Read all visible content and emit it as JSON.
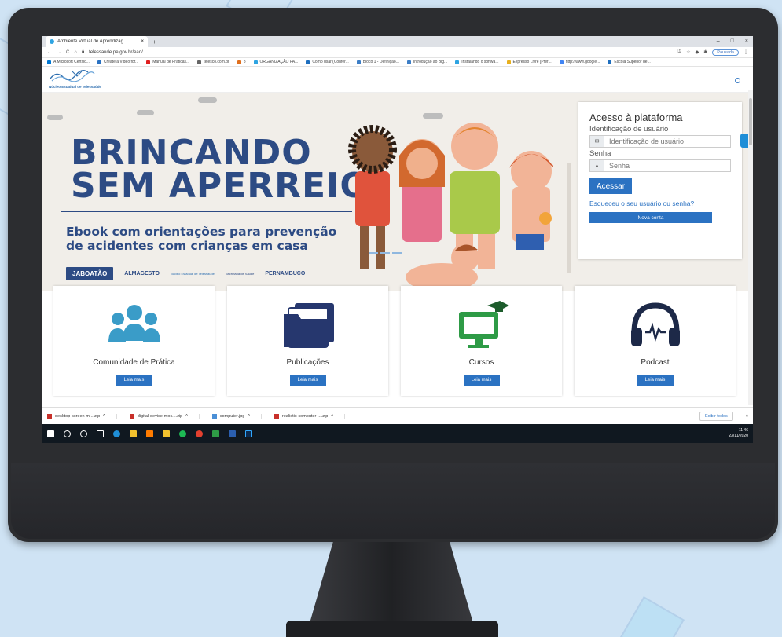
{
  "browser": {
    "tab_title": "Ambiente Virtual de Aprendizag",
    "tab_close": "×",
    "new_tab": "+",
    "window_controls": [
      "–",
      "□",
      "×"
    ],
    "url": "telessaude.pe.gov.br/ead/",
    "paused_label": "Pausada",
    "bookmarks": [
      {
        "label": "A Microsoft Certific...",
        "color": "#0078d4"
      },
      {
        "label": "Create a Video for...",
        "color": "#2b72c2"
      },
      {
        "label": "Manual de Práticas...",
        "color": "#e02020"
      },
      {
        "label": "telesco.com.br",
        "color": "#666666"
      },
      {
        "label": "o",
        "color": "#e0701e"
      },
      {
        "label": "ORGANIZAÇÃO PA...",
        "color": "#2ea4e2"
      },
      {
        "label": "Como usar (Confer...",
        "color": "#1f6fbf"
      },
      {
        "label": "Bloco 1 - Definição...",
        "color": "#3d7ec6"
      },
      {
        "label": "Introdução ao Big...",
        "color": "#3d7ec6"
      },
      {
        "label": "Instalando o softwa...",
        "color": "#2ea4e2"
      },
      {
        "label": "Expresso Livre [Pref...",
        "color": "#e8b01e"
      },
      {
        "label": "http://www.google...",
        "color": "#4285f4"
      },
      {
        "label": "Escola Superior de...",
        "color": "#1f6fbf"
      }
    ]
  },
  "site": {
    "logo_text": "Núcleo Estadual de Telessaúde"
  },
  "hero": {
    "title_line1": "BRINCANDO",
    "title_line2": "SEM APERREIO",
    "subtitle_line1": "Ebook com orientações para prevenção",
    "subtitle_line2": "de acidentes com crianças em casa",
    "logos": {
      "jaboatao": "JABOATÃO",
      "almagesto": "ALMAGESTO",
      "nes": "Núcleo Estadual de Telessaúde",
      "secretaria": "Secretaria de Saúde",
      "pernambuco": "PERNAMBUCO"
    }
  },
  "login": {
    "heading": "Acesso à plataforma",
    "user_label": "Identificação de usuário",
    "user_placeholder": "Identificação de usuário",
    "password_label": "Senha",
    "password_placeholder": "Senha",
    "submit": "Acessar",
    "forgot": "Esqueceu o seu usuário ou senha?",
    "new_account": "Nova conta"
  },
  "cards": [
    {
      "title": "Comunidade de Prática",
      "button": "Leia mais",
      "icon": "community-icon",
      "color": "#3a9cc8"
    },
    {
      "title": "Publicações",
      "button": "Leia mais",
      "icon": "folder-icon",
      "color": "#26376e"
    },
    {
      "title": "Cursos",
      "button": "Leia mais",
      "icon": "computer-graduation-icon",
      "color": "#2e9b46"
    },
    {
      "title": "Podcast",
      "button": "Leia mais",
      "icon": "headphones-icon",
      "color": "#1d2948"
    }
  ],
  "downloads": {
    "items": [
      {
        "name": "desktop-screen-m....zip"
      },
      {
        "name": "digital-device-moc....zip"
      },
      {
        "name": "computer.jpg"
      },
      {
        "name": "realistic-computer-....zip"
      }
    ],
    "show_all": "Exibir todos",
    "close": "×"
  },
  "taskbar": {
    "time": "11:46",
    "date": "23/11/2020"
  },
  "colors": {
    "primary": "#2b72c2",
    "hero_text": "#2d4b84"
  }
}
